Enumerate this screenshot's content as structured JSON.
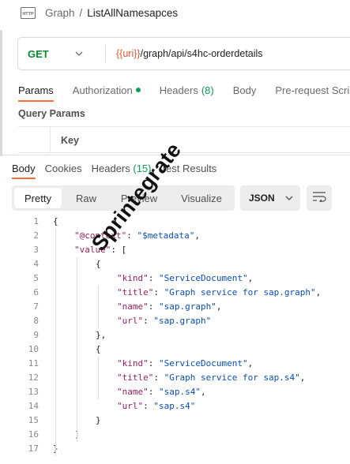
{
  "breadcrumb": {
    "icon": "http-icon",
    "parent": "Graph",
    "separator": "/",
    "current": "ListAllNamesapces"
  },
  "request": {
    "method": "GET",
    "url_variable": "{{uri}}",
    "url_path": "/graph/api/s4hc-orderdetails",
    "tabs": [
      {
        "label": "Params",
        "active": true
      },
      {
        "label": "Authorization",
        "indicator": "green-dot"
      },
      {
        "label": "Headers",
        "count": "(8)"
      },
      {
        "label": "Body"
      },
      {
        "label": "Pre-request Scrip"
      }
    ],
    "query_params_label": "Query Params",
    "key_header": "Key"
  },
  "response": {
    "tabs": [
      {
        "label": "Body",
        "active": true
      },
      {
        "label": "Cookies"
      },
      {
        "label": "Headers",
        "count": "(15)"
      },
      {
        "label": "Test Results"
      }
    ],
    "views": [
      {
        "label": "Pretty",
        "active": true
      },
      {
        "label": "Raw"
      },
      {
        "label": "Preview"
      },
      {
        "label": "Visualize"
      }
    ],
    "format": "JSON",
    "wrap_icon": "wrap-lines-icon"
  },
  "code_lines": [
    {
      "n": "1",
      "text": "{"
    },
    {
      "n": "2",
      "key": "\"@context\"",
      "value": "\"$metadata\"",
      "end": ","
    },
    {
      "n": "3",
      "key": "\"value\"",
      "value": "["
    },
    {
      "n": "4",
      "text": "{"
    },
    {
      "n": "5",
      "key": "\"kind\"",
      "value": "\"ServiceDocument\"",
      "end": ","
    },
    {
      "n": "6",
      "key": "\"title\"",
      "value": "\"Graph service for sap.graph\"",
      "end": ","
    },
    {
      "n": "7",
      "key": "\"name\"",
      "value": "\"sap.graph\"",
      "end": ","
    },
    {
      "n": "8",
      "key": "\"url\"",
      "value": "\"sap.graph\""
    },
    {
      "n": "9",
      "text": "},"
    },
    {
      "n": "10",
      "text": "{"
    },
    {
      "n": "11",
      "key": "\"kind\"",
      "value": "\"ServiceDocument\"",
      "end": ","
    },
    {
      "n": "12",
      "key": "\"title\"",
      "value": "\"Graph service for sap.s4\"",
      "end": ","
    },
    {
      "n": "13",
      "key": "\"name\"",
      "value": "\"sap.s4\"",
      "end": ","
    },
    {
      "n": "14",
      "key": "\"url\"",
      "value": "\"sap.s4\""
    },
    {
      "n": "15",
      "text": "}"
    },
    {
      "n": "16",
      "text": "]"
    },
    {
      "n": "17",
      "text": "}"
    }
  ],
  "watermark": "Sprintegrate",
  "colors": {
    "accent": "#ff6c37",
    "method": "#0b8a2e",
    "variable": "#e4572e",
    "json_key": "#9c1f5e",
    "json_string": "#0b4eb8"
  }
}
